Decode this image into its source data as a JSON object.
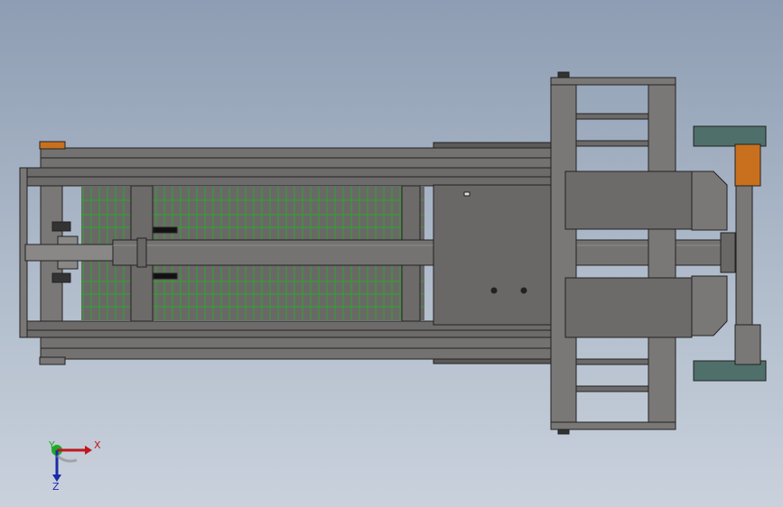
{
  "view": {
    "background_top": "#8e9db3",
    "background_bottom": "#c9d1dc"
  },
  "triad": {
    "x_label": "X",
    "y_label": "Y",
    "z_label": "Z",
    "x_color": "#c0161c",
    "y_color": "#1eaa28",
    "z_color": "#1c2aa8"
  },
  "model": {
    "body_color": "#6f6d6b",
    "edge_color": "#222222",
    "accent_color": "#c8701e",
    "cage_color": "#2ca62c"
  }
}
